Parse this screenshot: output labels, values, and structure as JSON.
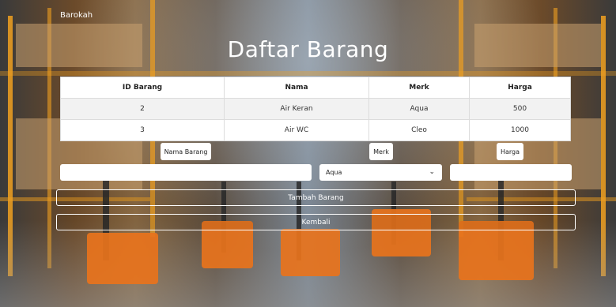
{
  "app": {
    "brand": "Barokah",
    "title": "Daftar Barang"
  },
  "table": {
    "headers": [
      "ID Barang",
      "Nama",
      "Merk",
      "Harga"
    ],
    "rows": [
      [
        "2",
        "Air Keran",
        "Aqua",
        "500"
      ],
      [
        "3",
        "Air WC",
        "Cleo",
        "1000"
      ]
    ]
  },
  "form": {
    "nama_label": "Nama Barang",
    "merk_label": "Merk",
    "harga_label": "Harga",
    "nama_value": "",
    "merk_selected": "Aqua",
    "harga_value": "",
    "add_button": "Tambah Barang",
    "back_button": "Kembali"
  },
  "icons": {
    "select_chevron": "chevron-down-icon"
  },
  "colors": {
    "accent": "#e8731c",
    "shelf": "#f0a020"
  }
}
